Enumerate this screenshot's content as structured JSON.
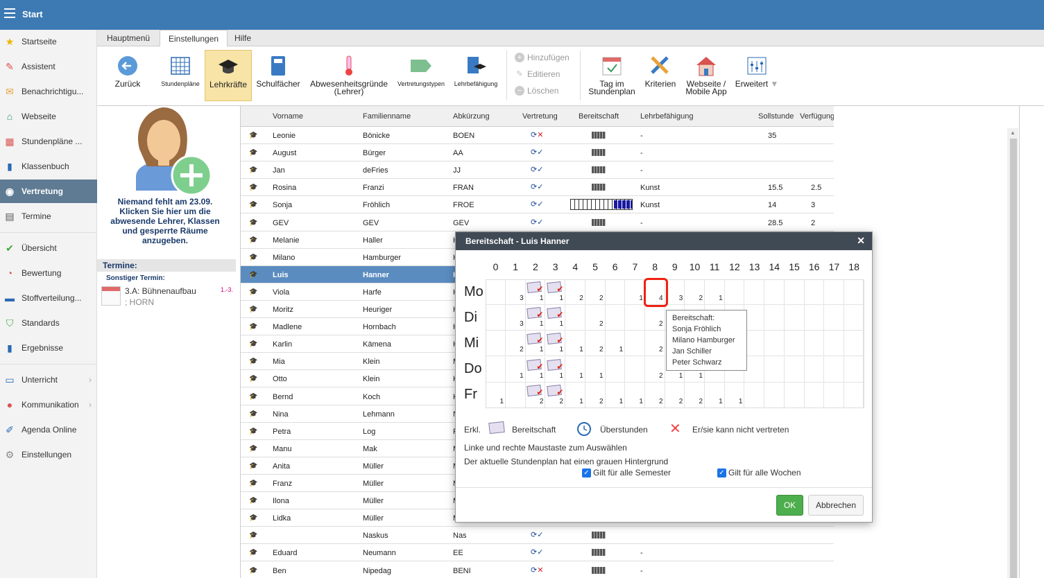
{
  "topbar": {
    "title": "Start"
  },
  "sidebar": {
    "items": [
      {
        "label": "Startseite",
        "icon": "star-icon"
      },
      {
        "label": "Assistent",
        "icon": "wand-icon"
      },
      {
        "label": "Benachrichtigu...",
        "icon": "envelope-icon"
      },
      {
        "label": "Webseite",
        "icon": "house-icon"
      },
      {
        "label": "Stundenpläne ...",
        "icon": "calendar-grid-icon"
      },
      {
        "label": "Klassenbuch",
        "icon": "book-icon"
      },
      {
        "label": "Vertretung",
        "icon": "person-icon"
      },
      {
        "label": "Termine",
        "icon": "calendar-icon"
      },
      {
        "label": "Übersicht",
        "icon": "check-circle-icon"
      },
      {
        "label": "Bewertung",
        "icon": "gauge-icon"
      },
      {
        "label": "Stoffverteilung...",
        "icon": "briefcase-icon"
      },
      {
        "label": "Standards",
        "icon": "shield-icon"
      },
      {
        "label": "Ergebnisse",
        "icon": "bar-chart-icon"
      },
      {
        "label": "Unterricht",
        "icon": "open-book-icon"
      },
      {
        "label": "Kommunikation",
        "icon": "chat-icon"
      },
      {
        "label": "Agenda Online",
        "icon": "pen-icon"
      },
      {
        "label": "Einstellungen",
        "icon": "gear-icon"
      }
    ]
  },
  "ribbon": {
    "tabs": [
      "Hauptmenü",
      "Einstellungen",
      "Hilfe"
    ],
    "buttons": {
      "back": "Zurück",
      "timetables": "Stundenpläne",
      "teachers": "Lehrkräfte",
      "subjects": "Schulfächer",
      "absence_1": "Abwesenheitsgründe",
      "absence_2": "(Lehrer)",
      "subst_types": "Vertretungstypen",
      "qualification": "Lehrbefähigung",
      "add": "Hinzufügen",
      "edit": "Editieren",
      "delete": "Löschen",
      "day_plan_1": "Tag im",
      "day_plan_2": "Stundenplan",
      "criteria": "Kriterien",
      "website_1": "Webseite /",
      "website_2": "Mobile App",
      "extended": "Erweitert"
    }
  },
  "leftpanel": {
    "absent_text": "Niemand fehlt am 23.09. Klicken Sie hier um die abwesende Lehrer, Klassen und gesperrte Räume anzugeben.",
    "termine_heading": "Termine:",
    "termine_sub": "Sonstiger Termin:",
    "termine_entry": "3.A: Bühnenaufbau",
    "termine_entry2": "; HORN",
    "termine_num": "1.-3."
  },
  "table": {
    "headers": {
      "firstname": "Vorname",
      "lastname": "Familienname",
      "abbr": "Abkürzung",
      "subst": "Vertretung",
      "standby": "Bereitschaft",
      "qual": "Lehrbefähigung",
      "target": "Sollstunde",
      "avail": "Verfügung"
    },
    "rows": [
      {
        "first": "Leonie",
        "last": "Bönicke",
        "abbr": "BOEN",
        "mark": "✕",
        "qual": "-",
        "target": "35",
        "avail": ""
      },
      {
        "first": "August",
        "last": "Bürger",
        "abbr": "AA",
        "mark": "✓",
        "qual": "-",
        "target": "",
        "avail": ""
      },
      {
        "first": "Jan",
        "last": "deFries",
        "abbr": "JJ",
        "mark": "✓",
        "qual": "-",
        "target": "",
        "avail": ""
      },
      {
        "first": "Rosina",
        "last": "Franzi",
        "abbr": "FRAN",
        "mark": "✓",
        "qual": "Kunst",
        "target": "15.5",
        "avail": "2.5"
      },
      {
        "first": "Sonja",
        "last": "Fröhlich",
        "abbr": "FROE",
        "mark": "✓",
        "qual": "Kunst",
        "target": "14",
        "avail": "3"
      },
      {
        "first": "GEV",
        "last": "GEV",
        "abbr": "GEV",
        "mark": "✓",
        "qual": "-",
        "target": "28.5",
        "avail": "2"
      },
      {
        "first": "Melanie",
        "last": "Haller",
        "abbr": "H",
        "mark": "",
        "qual": "",
        "target": "",
        "avail": ""
      },
      {
        "first": "Milano",
        "last": "Hamburger",
        "abbr": "H",
        "mark": "",
        "qual": "",
        "target": "",
        "avail": ""
      },
      {
        "first": "Luis",
        "last": "Hanner",
        "abbr": "H",
        "mark": "",
        "qual": "",
        "target": "",
        "avail": ""
      },
      {
        "first": "Viola",
        "last": "Harfe",
        "abbr": "H",
        "mark": "",
        "qual": "",
        "target": "",
        "avail": ""
      },
      {
        "first": "Moritz",
        "last": "Heuriger",
        "abbr": "H",
        "mark": "",
        "qual": "",
        "target": "",
        "avail": ""
      },
      {
        "first": "Madlene",
        "last": "Hornbach",
        "abbr": "H",
        "mark": "",
        "qual": "",
        "target": "",
        "avail": ""
      },
      {
        "first": "Karlin",
        "last": "Kämena",
        "abbr": "K",
        "mark": "",
        "qual": "",
        "target": "",
        "avail": ""
      },
      {
        "first": "Mia",
        "last": "Klein",
        "abbr": "M",
        "mark": "",
        "qual": "",
        "target": "",
        "avail": ""
      },
      {
        "first": "Otto",
        "last": "Klein",
        "abbr": "K",
        "mark": "",
        "qual": "",
        "target": "",
        "avail": ""
      },
      {
        "first": "Bernd",
        "last": "Koch",
        "abbr": "K",
        "mark": "",
        "qual": "",
        "target": "",
        "avail": ""
      },
      {
        "first": "Nina",
        "last": "Lehmann",
        "abbr": "N",
        "mark": "",
        "qual": "",
        "target": "",
        "avail": ""
      },
      {
        "first": "Petra",
        "last": "Log",
        "abbr": "P",
        "mark": "",
        "qual": "",
        "target": "",
        "avail": ""
      },
      {
        "first": "Manu",
        "last": "Mak",
        "abbr": "M",
        "mark": "",
        "qual": "",
        "target": "",
        "avail": ""
      },
      {
        "first": "Anita",
        "last": "Müller",
        "abbr": "M",
        "mark": "",
        "qual": "",
        "target": "",
        "avail": ""
      },
      {
        "first": "Franz",
        "last": "Müller",
        "abbr": "M",
        "mark": "",
        "qual": "",
        "target": "",
        "avail": ""
      },
      {
        "first": "Ilona",
        "last": "Müller",
        "abbr": "M",
        "mark": "",
        "qual": "",
        "target": "",
        "avail": ""
      },
      {
        "first": "Lidka",
        "last": "Müller",
        "abbr": "M",
        "mark": "",
        "qual": "",
        "target": "",
        "avail": ""
      },
      {
        "first": "",
        "last": "Naskus",
        "abbr": "Nas",
        "mark": "✓",
        "qual": "",
        "target": "",
        "avail": ""
      },
      {
        "first": "Eduard",
        "last": "Neumann",
        "abbr": "EE",
        "mark": "✓",
        "qual": "-",
        "target": "",
        "avail": ""
      },
      {
        "first": "Ben",
        "last": "Nipedag",
        "abbr": "BENI",
        "mark": "✕",
        "qual": "-",
        "target": "",
        "avail": ""
      }
    ]
  },
  "dialog": {
    "title": "Bereitschaft - Luis Hanner",
    "hours": [
      "0",
      "1",
      "2",
      "3",
      "4",
      "5",
      "6",
      "7",
      "8",
      "9",
      "10",
      "11",
      "12",
      "13",
      "14",
      "15",
      "16",
      "17",
      "18"
    ],
    "days": [
      "Mo",
      "Di",
      "Mi",
      "Do",
      "Fr"
    ],
    "grid": [
      [
        "",
        "3",
        "B1",
        "B1",
        "2",
        "2",
        "",
        "1",
        "4",
        "3",
        "2",
        "1",
        "",
        "",
        "",
        "",
        "",
        "",
        ""
      ],
      [
        "",
        "3",
        "B1",
        "B1",
        "",
        "2",
        "",
        "",
        "2",
        "",
        "",
        "",
        "",
        "",
        "",
        "",
        "",
        "",
        ""
      ],
      [
        "",
        "2",
        "B1",
        "B1",
        "1",
        "2",
        "1",
        "",
        "2",
        "",
        "",
        "",
        "",
        "",
        "",
        "",
        "",
        "",
        ""
      ],
      [
        "",
        "1",
        "B1",
        "B1",
        "1",
        "1",
        "",
        "",
        "2",
        "1",
        "1",
        "",
        "",
        "",
        "",
        "",
        "",
        "",
        ""
      ],
      [
        "1",
        "",
        "B2",
        "B2",
        "1",
        "2",
        "1",
        "1",
        "2",
        "2",
        "2",
        "1",
        "1",
        "",
        "",
        "",
        "",
        "",
        ""
      ]
    ],
    "tooltip": [
      "Bereitschaft:",
      "Sonja Fröhlich",
      "Milano Hamburger",
      "Jan Schiller",
      "Peter Schwarz"
    ],
    "legend_label": "Erkl.",
    "legend_standby": "Bereitschaft",
    "legend_overtime": "Überstunden",
    "legend_cannot": "Er/sie kann nicht vertreten",
    "note1": "Linke und rechte Maustaste zum Auswählen",
    "note2": "Der aktuelle Stundenplan hat einen grauen Hintergrund",
    "chk_semester": "Gilt für alle Semester",
    "chk_weeks": "Gilt für alle Wochen",
    "ok": "OK",
    "cancel": "Abbrechen"
  }
}
